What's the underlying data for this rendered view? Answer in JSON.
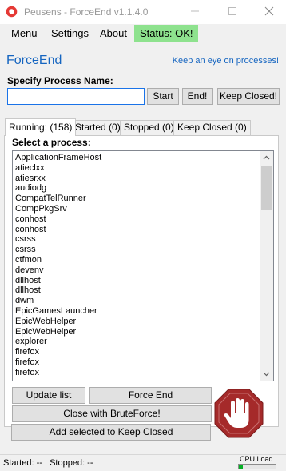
{
  "window": {
    "title": "Peusens - ForceEnd v1.1.4.0"
  },
  "menu": {
    "items": [
      "Menu",
      "Settings",
      "About"
    ],
    "status": "Status: OK!"
  },
  "header": {
    "app_name": "ForceEnd",
    "tagline": "Keep an eye on processes!"
  },
  "process_input": {
    "label": "Specify Process Name:",
    "value": "",
    "placeholder": ""
  },
  "buttons": {
    "start": "Start",
    "end": "End!",
    "keep_closed": "Keep Closed!",
    "update_list": "Update list",
    "force_end": "Force End",
    "brute_force": "Close with BruteForce!",
    "add_keep_closed": "Add selected to Keep Closed"
  },
  "tabs": [
    "Running: (158)",
    "Started (0)",
    "Stopped (0)",
    "Keep Closed (0)"
  ],
  "process_list": {
    "label": "Select a process:",
    "items": [
      "ApplicationFrameHost",
      "atieclxx",
      "atiesrxx",
      "audiodg",
      "CompatTelRunner",
      "CompPkgSrv",
      "conhost",
      "conhost",
      "csrss",
      "csrss",
      "ctfmon",
      "devenv",
      "dllhost",
      "dllhost",
      "dwm",
      "EpicGamesLauncher",
      "EpicWebHelper",
      "EpicWebHelper",
      "explorer",
      "firefox",
      "firefox",
      "firefox"
    ]
  },
  "statusbar": {
    "text": "Started: --   Stopped: --",
    "cpu_label": "CPU Load",
    "cpu_load_fraction": 0.1
  },
  "colors": {
    "accent": "#1565c0",
    "status_ok_bg": "#8ee28e",
    "stop_sign": "#a52a2a",
    "cpu_fill": "#06b025"
  }
}
